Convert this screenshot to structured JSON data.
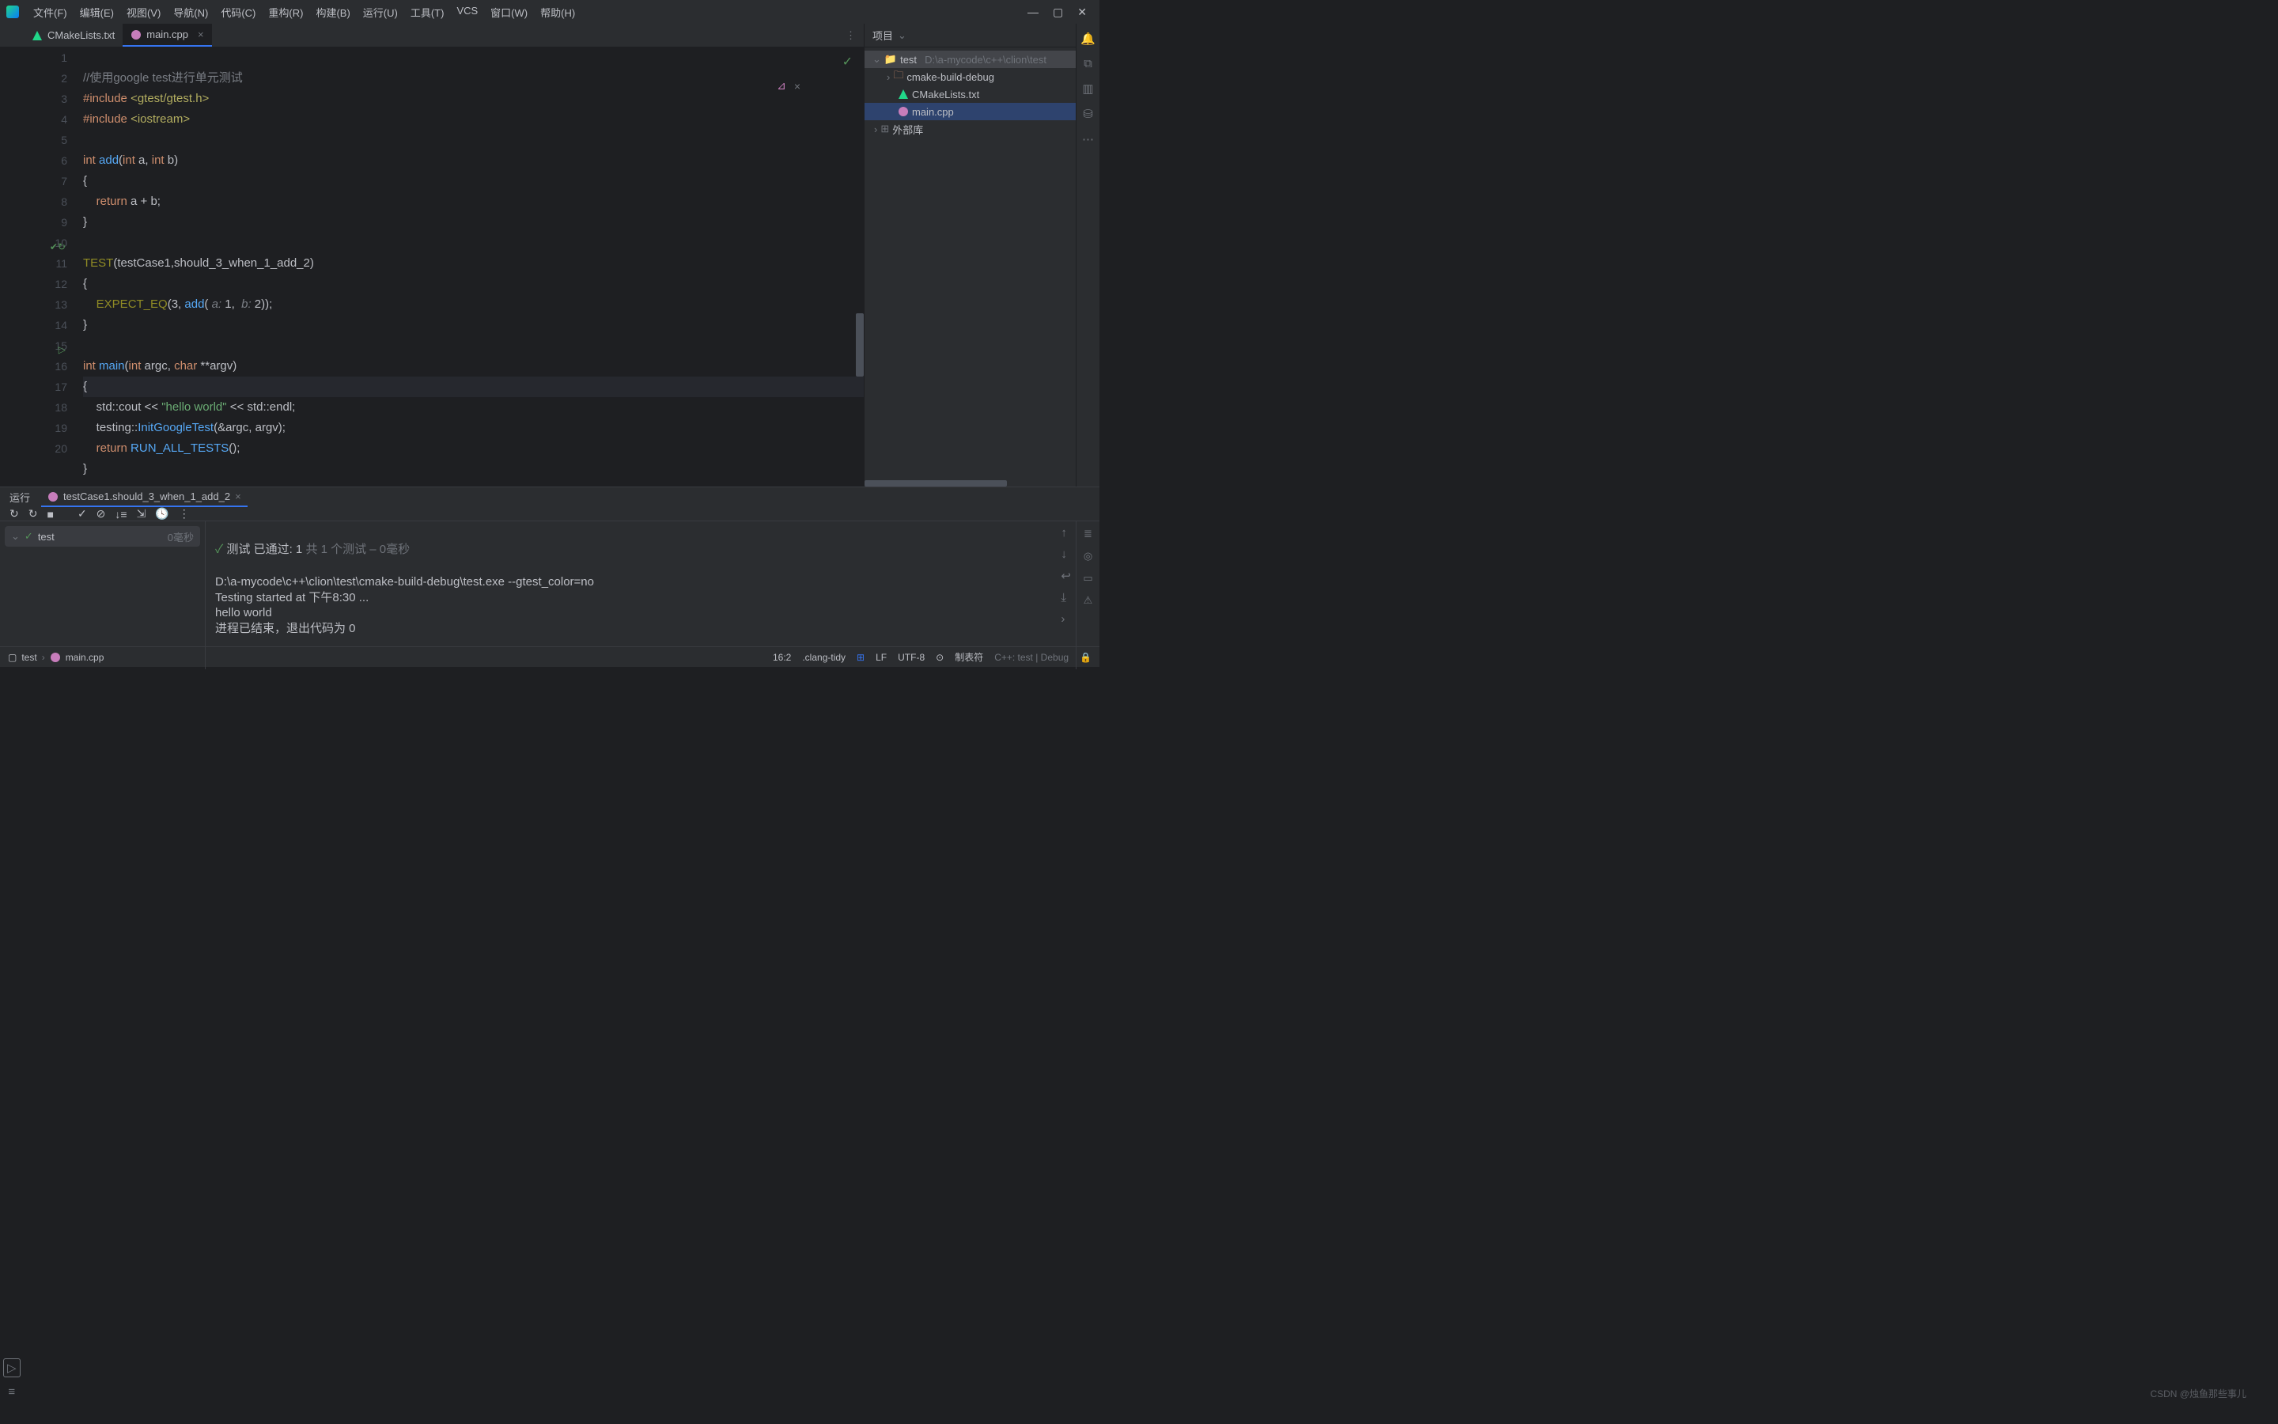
{
  "menu": {
    "items": [
      "文件(F)",
      "编辑(E)",
      "视图(V)",
      "导航(N)",
      "代码(C)",
      "重构(R)",
      "构建(B)",
      "运行(U)",
      "工具(T)",
      "VCS",
      "窗口(W)",
      "帮助(H)"
    ]
  },
  "tabs": {
    "t0": "CMakeLists.txt",
    "t1": "main.cpp"
  },
  "project": {
    "title": "项目",
    "root": "test",
    "rootPath": "D:\\a-mycode\\c++\\clion\\test",
    "folder": "cmake-build-debug",
    "file0": "CMakeLists.txt",
    "file1": "main.cpp",
    "ext": "外部库"
  },
  "code": {
    "l1_comment": "//使用google test进行单元测试",
    "l2": "#include <gtest/gtest.h>",
    "l3": "#include <iostream>",
    "l5_int": "int ",
    "l5_add": "add",
    "l5_sig": "(int a, int b)",
    "l6": "{",
    "l7_ret": "    return ",
    "l7_expr": "a + b;",
    "l8": "}",
    "l10_test": "TEST",
    "l10_args": "(testCase1,should_3_when_1_add_2)",
    "l11": "{",
    "l12_eq": "    EXPECT_EQ",
    "l12_open": "(3, ",
    "l12_add": "add",
    "l12_p": "( ",
    "l12_a": "a:",
    "l12_av": " 1,  ",
    "l12_b": "b:",
    "l12_bv": " 2));",
    "l13": "}",
    "l15_int": "int ",
    "l15_main": "main",
    "l15_sig": "(int argc, char **argv)",
    "l16": "{",
    "l17_std": "    std::",
    "l17_cout": "cout ",
    "l17_op1": "<< ",
    "l17_str": "\"hello world\"",
    "l17_op2": " << std::",
    "l17_endl": "endl",
    ";": ";",
    "l18_ns": "    testing::",
    "l18_fn": "InitGoogleTest",
    "l18_args": "(&argc, argv);",
    "l19_ret": "    return ",
    "l19_run": "RUN_ALL_TESTS",
    "l19_end": "();",
    "l20": "}"
  },
  "lines": [
    "1",
    "2",
    "3",
    "4",
    "5",
    "6",
    "7",
    "8",
    "9",
    "10",
    "11",
    "12",
    "13",
    "14",
    "15",
    "16",
    "17",
    "18",
    "19",
    "20"
  ],
  "run": {
    "tab": "运行",
    "config": "testCase1.should_3_when_1_add_2",
    "testName": "test",
    "testTime": "0毫秒",
    "passedPrefix": "测试 已通过: 1",
    "passedSuffix": "共 1 个测试 – 0毫秒",
    "out1": "D:\\a-mycode\\c++\\clion\\test\\cmake-build-debug\\test.exe --gtest_color=no",
    "out2": "Testing started at 下午8:30 ...",
    "out3": "hello world",
    "out4": "进程已结束，退出代码为 0"
  },
  "status": {
    "crumb1": "test",
    "crumb2": "main.cpp",
    "pos": "16:2",
    "tidy": ".clang-tidy",
    "lf": "LF",
    "enc": "UTF-8",
    "indent": "制表符",
    "cfg": "C++: test | Debug",
    "watermark": "CSDN @烛鱼那些事儿"
  }
}
